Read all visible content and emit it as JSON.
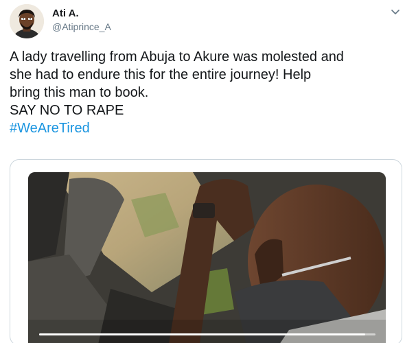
{
  "author": {
    "display_name": "Ati A.",
    "handle": "@Atiprince_A",
    "avatar_icon": "cartoon-avatar-icon"
  },
  "menu_icon": "chevron-down-icon",
  "tweet": {
    "lines": [
      "A lady travelling from Abuja to Akure was molested and",
      "she had to endure this for the entire journey! Help",
      "bring this man to book.",
      "SAY NO TO RAPE"
    ],
    "hashtag": "#WeAreTired"
  },
  "media": {
    "type": "video",
    "progress_fraction": 0.97
  },
  "colors": {
    "hashtag": "#1b95e0",
    "handle": "#657786",
    "text": "#14171a"
  }
}
